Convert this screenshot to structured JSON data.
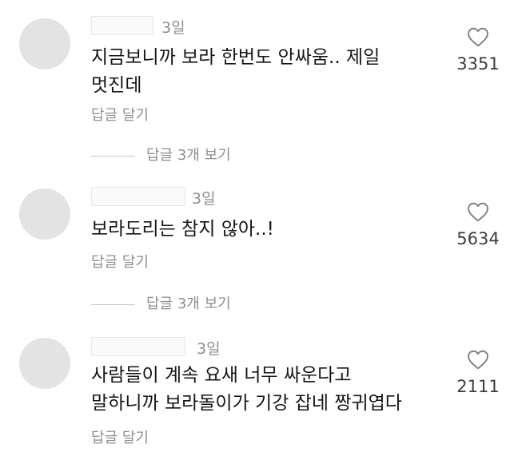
{
  "comments": [
    {
      "time": "3일",
      "text": "지금보니까 보라 한번도 안싸움.. 제일\n멋진데",
      "reply_label": "답글 달기",
      "likes": "3351",
      "view_replies": "답글 3개 보기"
    },
    {
      "time": "3일",
      "text": "보라도리는 참지 않아..!",
      "reply_label": "답글 달기",
      "likes": "5634",
      "view_replies": "답글 3개 보기"
    },
    {
      "time": "3일",
      "text": "사람들이 계속 요새 너무 싸운다고\n말하니까 보라돌이가 기강 잡네 짱귀엽다",
      "reply_label": "답글 달기",
      "likes": "2111"
    }
  ],
  "icons": {
    "like": "heart-outline-icon"
  },
  "colors": {
    "avatar": "#e3e3e3",
    "secondary_text": "#8e8e8e",
    "text": "#151515"
  }
}
